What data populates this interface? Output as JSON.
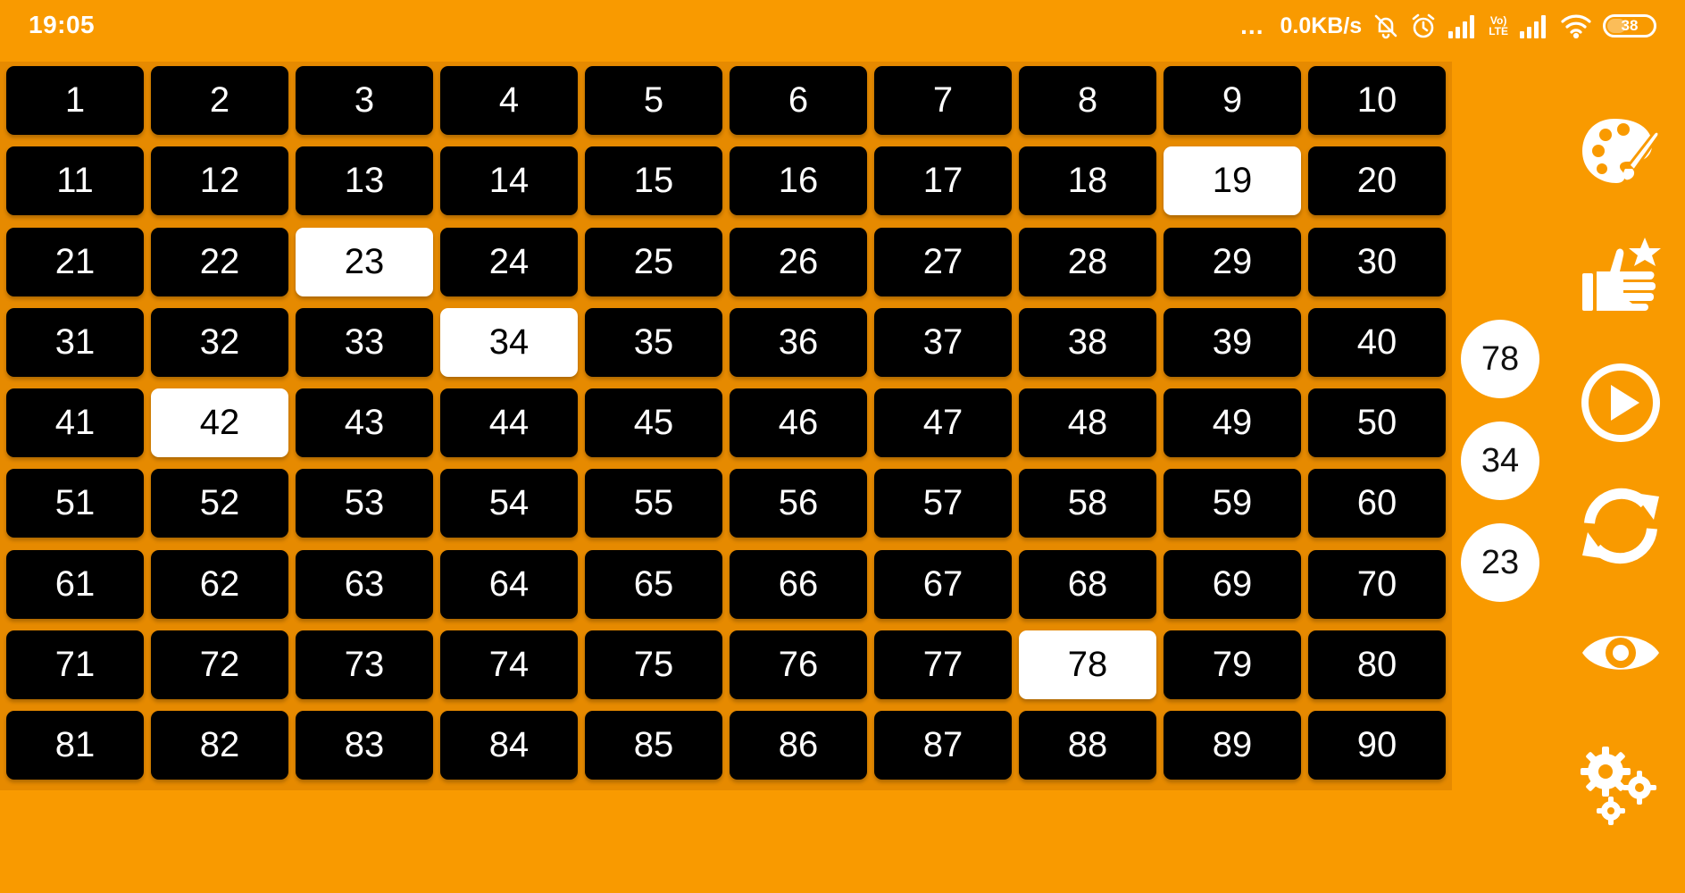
{
  "status_bar": {
    "time": "19:05",
    "dots": "...",
    "network_speed": "0.0KB/s",
    "lte_top": "Vo)",
    "lte_bottom": "LTE",
    "battery_level": "38"
  },
  "board": {
    "numbers": [
      1,
      2,
      3,
      4,
      5,
      6,
      7,
      8,
      9,
      10,
      11,
      12,
      13,
      14,
      15,
      16,
      17,
      18,
      19,
      20,
      21,
      22,
      23,
      24,
      25,
      26,
      27,
      28,
      29,
      30,
      31,
      32,
      33,
      34,
      35,
      36,
      37,
      38,
      39,
      40,
      41,
      42,
      43,
      44,
      45,
      46,
      47,
      48,
      49,
      50,
      51,
      52,
      53,
      54,
      55,
      56,
      57,
      58,
      59,
      60,
      61,
      62,
      63,
      64,
      65,
      66,
      67,
      68,
      69,
      70,
      71,
      72,
      73,
      74,
      75,
      76,
      77,
      78,
      79,
      80,
      81,
      82,
      83,
      84,
      85,
      86,
      87,
      88,
      89,
      90
    ],
    "drawn": [
      19,
      23,
      34,
      42,
      78
    ]
  },
  "history": {
    "recent_numbers": [
      "78",
      "34",
      "23"
    ]
  },
  "toolbar": {
    "items": [
      "palette-icon",
      "rate-icon",
      "play-icon",
      "refresh-icon",
      "eye-icon",
      "settings-icon"
    ]
  },
  "colors": {
    "background": "#f99a00",
    "board_background": "#e68a00",
    "cell": "#000000",
    "cell_drawn": "#ffffff"
  }
}
